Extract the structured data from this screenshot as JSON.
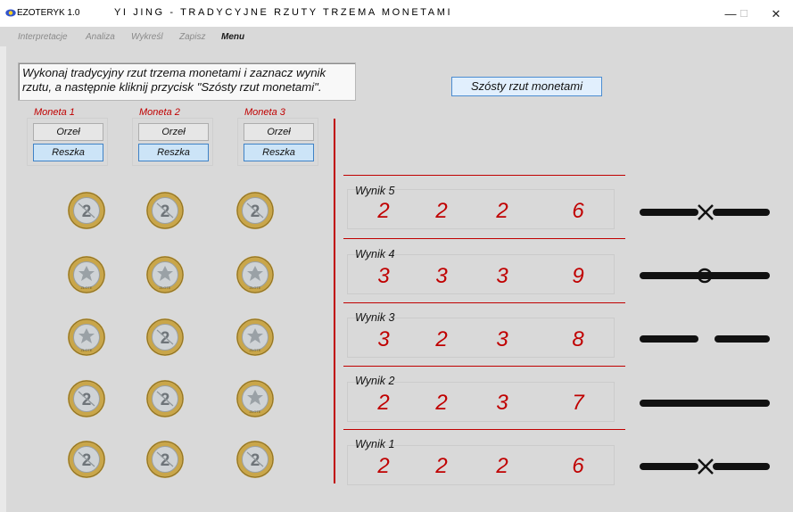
{
  "window": {
    "app_name": "EZOTERYK 1.0",
    "title": "YI JING - TRADYCYJNE RZUTY TRZEMA MONETAMI",
    "minimize": "—",
    "maximize": "☐",
    "close": "✕"
  },
  "menu": [
    "Interpretacje",
    "Analiza",
    "Wykreśl",
    "Zapisz",
    "Menu"
  ],
  "instruction": "Wykonaj tradycyjny rzut trzema monetami i zaznacz wynik\nrzutu, a następnie kliknij przycisk \"Szósty rzut monetami\".",
  "sixth_throw_button": "Szósty rzut monetami",
  "coins": [
    {
      "label": "Moneta 1",
      "heads": "Orzeł",
      "tails": "Reszka",
      "selected": "Reszka"
    },
    {
      "label": "Moneta 2",
      "heads": "Orzeł",
      "tails": "Reszka",
      "selected": "Reszka"
    },
    {
      "label": "Moneta 3",
      "heads": "Orzeł",
      "tails": "Reszka",
      "selected": "Reszka"
    }
  ],
  "coin_grid": [
    [
      "reverse",
      "reverse",
      "reverse"
    ],
    [
      "obverse",
      "obverse",
      "obverse"
    ],
    [
      "obverse",
      "reverse",
      "obverse"
    ],
    [
      "reverse",
      "reverse",
      "obverse"
    ],
    [
      "reverse",
      "reverse",
      "reverse"
    ]
  ],
  "results": [
    {
      "label": "Wynik 5",
      "values": [
        "2",
        "2",
        "2",
        "6"
      ],
      "line": "yin-changing"
    },
    {
      "label": "Wynik 4",
      "values": [
        "3",
        "3",
        "3",
        "9"
      ],
      "line": "yang-changing"
    },
    {
      "label": "Wynik 3",
      "values": [
        "3",
        "2",
        "3",
        "8"
      ],
      "line": "yin"
    },
    {
      "label": "Wynik 2",
      "values": [
        "2",
        "2",
        "3",
        "7"
      ],
      "line": "yang"
    },
    {
      "label": "Wynik 1",
      "values": [
        "2",
        "2",
        "2",
        "6"
      ],
      "line": "yin-changing"
    }
  ],
  "colors": {
    "accent": "#c00000",
    "button_selected": "#cce4f7",
    "button_border": "#3f82c6"
  }
}
